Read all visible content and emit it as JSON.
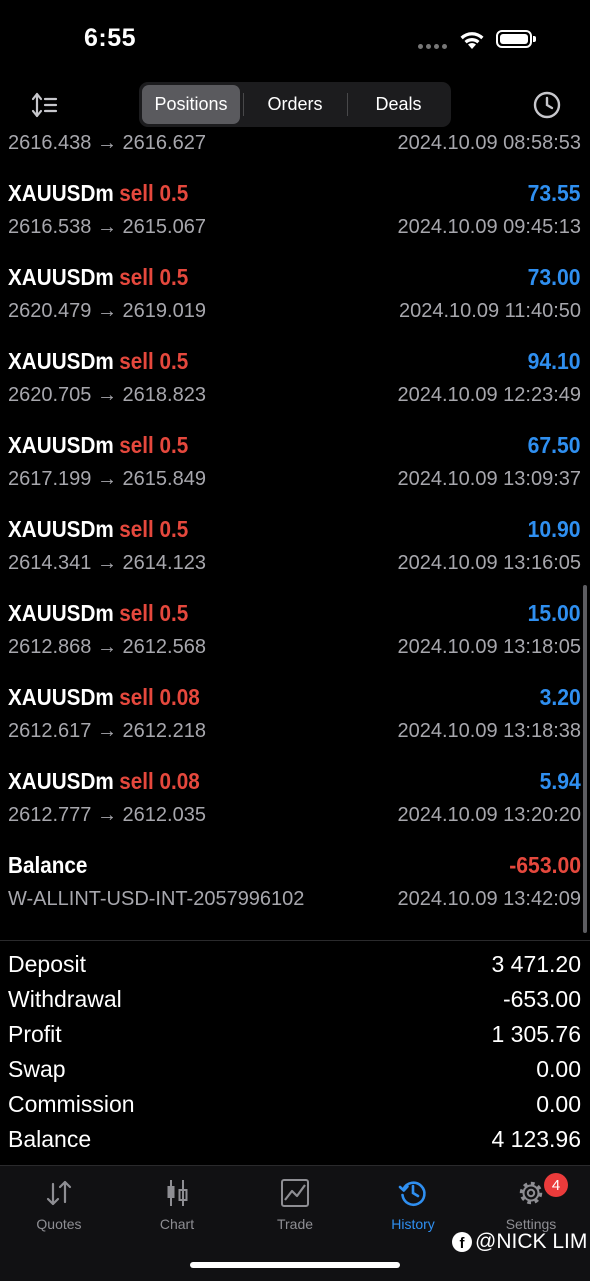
{
  "status": {
    "time": "6:55"
  },
  "toolbar": {
    "tabs": [
      "Positions",
      "Orders",
      "Deals"
    ],
    "active_tab": "Positions"
  },
  "partial_row": {
    "prices": "2616.438 → 2616.627",
    "datetime": "2024.10.09 08:58:53"
  },
  "deals": [
    {
      "symbol": "XAUUSDm",
      "type": "sell 0.5",
      "profit": "73.55",
      "prices": "2616.538 → 2615.067",
      "datetime": "2024.10.09 09:45:13"
    },
    {
      "symbol": "XAUUSDm",
      "type": "sell 0.5",
      "profit": "73.00",
      "prices": "2620.479 → 2619.019",
      "datetime": "2024.10.09 11:40:50"
    },
    {
      "symbol": "XAUUSDm",
      "type": "sell 0.5",
      "profit": "94.10",
      "prices": "2620.705 → 2618.823",
      "datetime": "2024.10.09 12:23:49"
    },
    {
      "symbol": "XAUUSDm",
      "type": "sell 0.5",
      "profit": "67.50",
      "prices": "2617.199 → 2615.849",
      "datetime": "2024.10.09 13:09:37"
    },
    {
      "symbol": "XAUUSDm",
      "type": "sell 0.5",
      "profit": "10.90",
      "prices": "2614.341 → 2614.123",
      "datetime": "2024.10.09 13:16:05"
    },
    {
      "symbol": "XAUUSDm",
      "type": "sell 0.5",
      "profit": "15.00",
      "prices": "2612.868 → 2612.568",
      "datetime": "2024.10.09 13:18:05"
    },
    {
      "symbol": "XAUUSDm",
      "type": "sell 0.08",
      "profit": "3.20",
      "prices": "2612.617 → 2612.218",
      "datetime": "2024.10.09 13:18:38"
    },
    {
      "symbol": "XAUUSDm",
      "type": "sell 0.08",
      "profit": "5.94",
      "prices": "2612.777 → 2612.035",
      "datetime": "2024.10.09 13:20:20"
    }
  ],
  "balance_row": {
    "label": "Balance",
    "amount": "-653.00",
    "comment": "W-ALLINT-USD-INT-2057996102",
    "datetime": "2024.10.09 13:42:09"
  },
  "summary": [
    {
      "label": "Deposit",
      "value": "3 471.20"
    },
    {
      "label": "Withdrawal",
      "value": "-653.00"
    },
    {
      "label": "Profit",
      "value": "1 305.76"
    },
    {
      "label": "Swap",
      "value": "0.00"
    },
    {
      "label": "Commission",
      "value": "0.00"
    },
    {
      "label": "Balance",
      "value": "4 123.96"
    }
  ],
  "tabbar": {
    "items": [
      {
        "label": "Quotes",
        "icon": "quotes-arrows-icon"
      },
      {
        "label": "Chart",
        "icon": "candlestick-chart-icon"
      },
      {
        "label": "Trade",
        "icon": "trade-line-chart-icon"
      },
      {
        "label": "History",
        "icon": "history-clock-icon"
      },
      {
        "label": "Settings",
        "icon": "gear-icon"
      }
    ],
    "active": "History",
    "settings_badge": "4"
  },
  "watermark": {
    "text": "@NICK LIM"
  },
  "colors": {
    "profit": "#2f8ff0",
    "loss": "#e5483d",
    "accent": "#2f8ff0"
  }
}
